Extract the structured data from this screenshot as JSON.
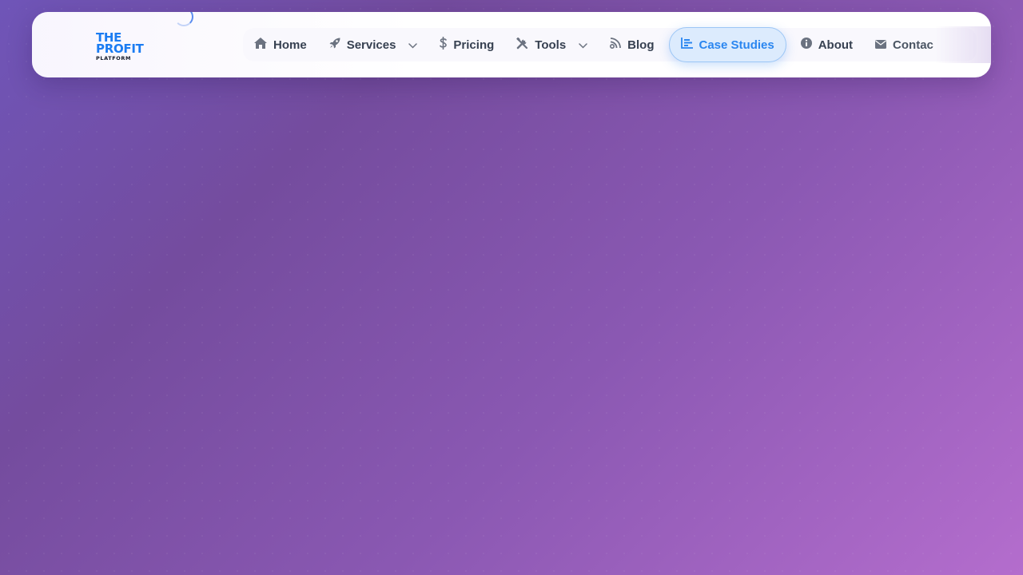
{
  "brand": {
    "line1": "THE",
    "line2": "PROFIT",
    "line3": "PLATFORM"
  },
  "nav": {
    "items": [
      {
        "label": "Home",
        "icon": "home-icon"
      },
      {
        "label": "Services",
        "icon": "rocket-icon",
        "dropdown": true
      },
      {
        "label": "Pricing",
        "icon": "dollar-icon"
      },
      {
        "label": "Tools",
        "icon": "tools-icon",
        "dropdown": true
      },
      {
        "label": "Blog",
        "icon": "blog-icon"
      },
      {
        "label": "Case Studies",
        "icon": "bar-chart-icon",
        "active": true
      },
      {
        "label": "About",
        "icon": "info-icon"
      },
      {
        "label": "Contac",
        "icon": "envelope-icon"
      }
    ]
  },
  "colors": {
    "accent": "#2a86f0",
    "brand": "#1b7cf2",
    "nav_text": "#374151",
    "bg_start": "#6f55b8",
    "bg_end": "#b46dcd"
  }
}
